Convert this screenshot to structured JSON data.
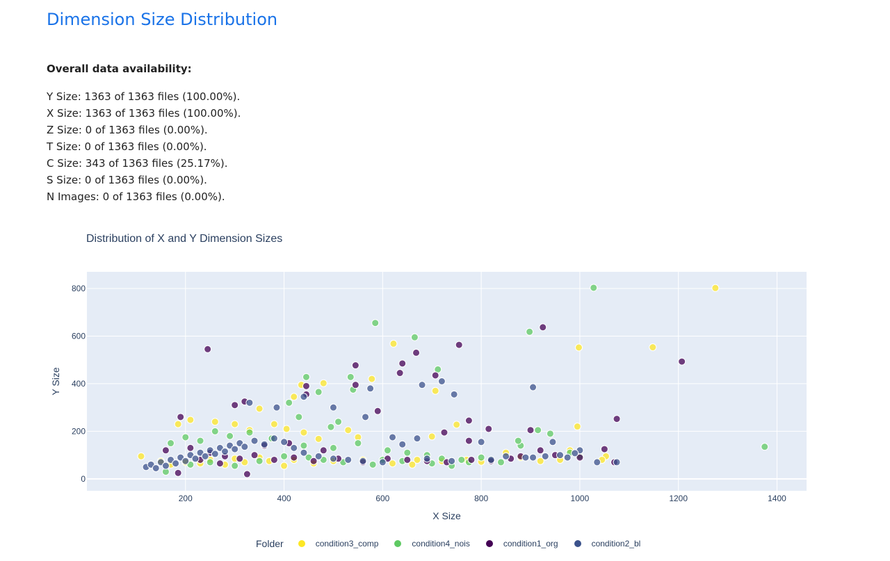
{
  "page": {
    "title": "Dimension Size Distribution"
  },
  "availability": {
    "heading": "Overall data availability:",
    "lines": [
      "Y Size: 1363 of 1363 files (100.00%).",
      "X Size: 1363 of 1363 files (100.00%).",
      "Z Size: 0 of 1363 files (0.00%).",
      "T Size: 0 of 1363 files (0.00%).",
      "C Size: 343 of 1363 files (25.17%).",
      "S Size: 0 of 1363 files (0.00%).",
      "N Images: 0 of 1363 files (0.00%)."
    ]
  },
  "chart_data": {
    "type": "scatter",
    "title": "Distribution of X and Y Dimension Sizes",
    "xlabel": "X Size",
    "ylabel": "Y Size",
    "xlim": [
      0,
      1460
    ],
    "ylim": [
      -50,
      870
    ],
    "xticks": [
      200,
      400,
      600,
      800,
      1000,
      1200,
      1400
    ],
    "yticks": [
      0,
      200,
      400,
      600,
      800
    ],
    "grid": true,
    "legend": {
      "title": "Folder",
      "placement": "bottom"
    },
    "colors": {
      "plot_bg": "#e5ecf6",
      "axis_text": "#2a3f5f"
    },
    "series": [
      {
        "name": "condition3_comp",
        "color": "#fde725",
        "points": [
          [
            1275,
            802
          ],
          [
            1148,
            553
          ],
          [
            998,
            552
          ],
          [
            622,
            568
          ],
          [
            707,
            370
          ],
          [
            480,
            402
          ],
          [
            435,
            395
          ],
          [
            578,
            420
          ],
          [
            420,
            345
          ],
          [
            350,
            295
          ],
          [
            995,
            220
          ],
          [
            750,
            228
          ],
          [
            700,
            178
          ],
          [
            1053,
            95
          ],
          [
            185,
            230
          ],
          [
            210,
            248
          ],
          [
            260,
            240
          ],
          [
            300,
            230
          ],
          [
            330,
            205
          ],
          [
            380,
            230
          ],
          [
            405,
            210
          ],
          [
            440,
            195
          ],
          [
            470,
            168
          ],
          [
            530,
            205
          ],
          [
            550,
            175
          ],
          [
            110,
            95
          ],
          [
            150,
            75
          ],
          [
            170,
            60
          ],
          [
            200,
            70
          ],
          [
            230,
            65
          ],
          [
            250,
            80
          ],
          [
            280,
            60
          ],
          [
            300,
            85
          ],
          [
            320,
            70
          ],
          [
            350,
            90
          ],
          [
            370,
            75
          ],
          [
            400,
            55
          ],
          [
            420,
            80
          ],
          [
            460,
            65
          ],
          [
            500,
            75
          ],
          [
            560,
            80
          ],
          [
            620,
            65
          ],
          [
            670,
            80
          ],
          [
            720,
            75
          ],
          [
            770,
            80
          ],
          [
            800,
            72
          ],
          [
            850,
            110
          ],
          [
            880,
            90
          ],
          [
            920,
            75
          ],
          [
            960,
            80
          ],
          [
            1045,
            80
          ],
          [
            980,
            120
          ],
          [
            660,
            60
          ]
        ]
      },
      {
        "name": "condition4_nois",
        "color": "#5ec962",
        "points": [
          [
            1375,
            135
          ],
          [
            585,
            655
          ],
          [
            665,
            595
          ],
          [
            898,
            618
          ],
          [
            712,
            460
          ],
          [
            535,
            428
          ],
          [
            445,
            428
          ],
          [
            470,
            365
          ],
          [
            410,
            320
          ],
          [
            1028,
            803
          ],
          [
            540,
            375
          ],
          [
            510,
            240
          ],
          [
            495,
            218
          ],
          [
            430,
            260
          ],
          [
            170,
            150
          ],
          [
            200,
            175
          ],
          [
            230,
            160
          ],
          [
            260,
            200
          ],
          [
            290,
            180
          ],
          [
            330,
            195
          ],
          [
            375,
            170
          ],
          [
            440,
            140
          ],
          [
            500,
            130
          ],
          [
            550,
            150
          ],
          [
            610,
            120
          ],
          [
            650,
            110
          ],
          [
            690,
            100
          ],
          [
            720,
            85
          ],
          [
            760,
            80
          ],
          [
            800,
            90
          ],
          [
            840,
            70
          ],
          [
            880,
            140
          ],
          [
            940,
            190
          ],
          [
            915,
            205
          ],
          [
            980,
            110
          ],
          [
            1000,
            95
          ],
          [
            160,
            30
          ],
          [
            210,
            60
          ],
          [
            250,
            70
          ],
          [
            300,
            55
          ],
          [
            350,
            75
          ],
          [
            400,
            95
          ],
          [
            450,
            90
          ],
          [
            480,
            80
          ],
          [
            520,
            70
          ],
          [
            580,
            60
          ],
          [
            600,
            80
          ],
          [
            640,
            75
          ],
          [
            700,
            65
          ],
          [
            740,
            55
          ],
          [
            775,
            70
          ],
          [
            820,
            80
          ],
          [
            875,
            160
          ]
        ]
      },
      {
        "name": "condition1_org",
        "color": "#440154",
        "points": [
          [
            925,
            637
          ],
          [
            1207,
            493
          ],
          [
            245,
            545
          ],
          [
            755,
            563
          ],
          [
            668,
            530
          ],
          [
            545,
            477
          ],
          [
            640,
            485
          ],
          [
            707,
            435
          ],
          [
            635,
            445
          ],
          [
            545,
            395
          ],
          [
            445,
            390
          ],
          [
            445,
            355
          ],
          [
            590,
            285
          ],
          [
            1075,
            252
          ],
          [
            775,
            245
          ],
          [
            815,
            210
          ],
          [
            725,
            195
          ],
          [
            775,
            160
          ],
          [
            860,
            85
          ],
          [
            900,
            205
          ],
          [
            920,
            120
          ],
          [
            1050,
            125
          ],
          [
            320,
            325
          ],
          [
            300,
            310
          ],
          [
            190,
            260
          ],
          [
            185,
            25
          ],
          [
            325,
            20
          ],
          [
            160,
            120
          ],
          [
            210,
            130
          ],
          [
            250,
            110
          ],
          [
            280,
            95
          ],
          [
            310,
            85
          ],
          [
            340,
            100
          ],
          [
            380,
            80
          ],
          [
            420,
            90
          ],
          [
            460,
            75
          ],
          [
            510,
            85
          ],
          [
            560,
            70
          ],
          [
            610,
            85
          ],
          [
            650,
            80
          ],
          [
            690,
            75
          ],
          [
            730,
            70
          ],
          [
            780,
            80
          ],
          [
            820,
            75
          ],
          [
            880,
            95
          ],
          [
            950,
            100
          ],
          [
            1000,
            90
          ],
          [
            1070,
            70
          ],
          [
            230,
            80
          ],
          [
            270,
            65
          ],
          [
            360,
            140
          ],
          [
            410,
            150
          ],
          [
            480,
            120
          ]
        ]
      },
      {
        "name": "condition2_bl",
        "color": "#3b528b",
        "points": [
          [
            905,
            385
          ],
          [
            575,
            380
          ],
          [
            720,
            410
          ],
          [
            680,
            395
          ],
          [
            745,
            355
          ],
          [
            500,
            300
          ],
          [
            440,
            345
          ],
          [
            385,
            300
          ],
          [
            330,
            320
          ],
          [
            565,
            260
          ],
          [
            620,
            175
          ],
          [
            670,
            170
          ],
          [
            640,
            145
          ],
          [
            800,
            155
          ],
          [
            945,
            155
          ],
          [
            1000,
            120
          ],
          [
            1035,
            70
          ],
          [
            1075,
            70
          ],
          [
            960,
            100
          ],
          [
            990,
            108
          ],
          [
            905,
            90
          ],
          [
            120,
            50
          ],
          [
            130,
            60
          ],
          [
            140,
            45
          ],
          [
            150,
            70
          ],
          [
            160,
            55
          ],
          [
            170,
            80
          ],
          [
            180,
            65
          ],
          [
            190,
            90
          ],
          [
            200,
            75
          ],
          [
            210,
            100
          ],
          [
            220,
            85
          ],
          [
            230,
            110
          ],
          [
            240,
            95
          ],
          [
            250,
            120
          ],
          [
            260,
            105
          ],
          [
            270,
            130
          ],
          [
            280,
            115
          ],
          [
            290,
            140
          ],
          [
            300,
            125
          ],
          [
            310,
            150
          ],
          [
            320,
            135
          ],
          [
            340,
            160
          ],
          [
            360,
            145
          ],
          [
            380,
            170
          ],
          [
            400,
            155
          ],
          [
            420,
            130
          ],
          [
            440,
            110
          ],
          [
            470,
            95
          ],
          [
            500,
            85
          ],
          [
            530,
            80
          ],
          [
            560,
            75
          ],
          [
            600,
            70
          ],
          [
            690,
            85
          ],
          [
            740,
            75
          ],
          [
            820,
            80
          ],
          [
            850,
            95
          ],
          [
            890,
            90
          ],
          [
            930,
            95
          ],
          [
            975,
            90
          ]
        ]
      }
    ]
  }
}
